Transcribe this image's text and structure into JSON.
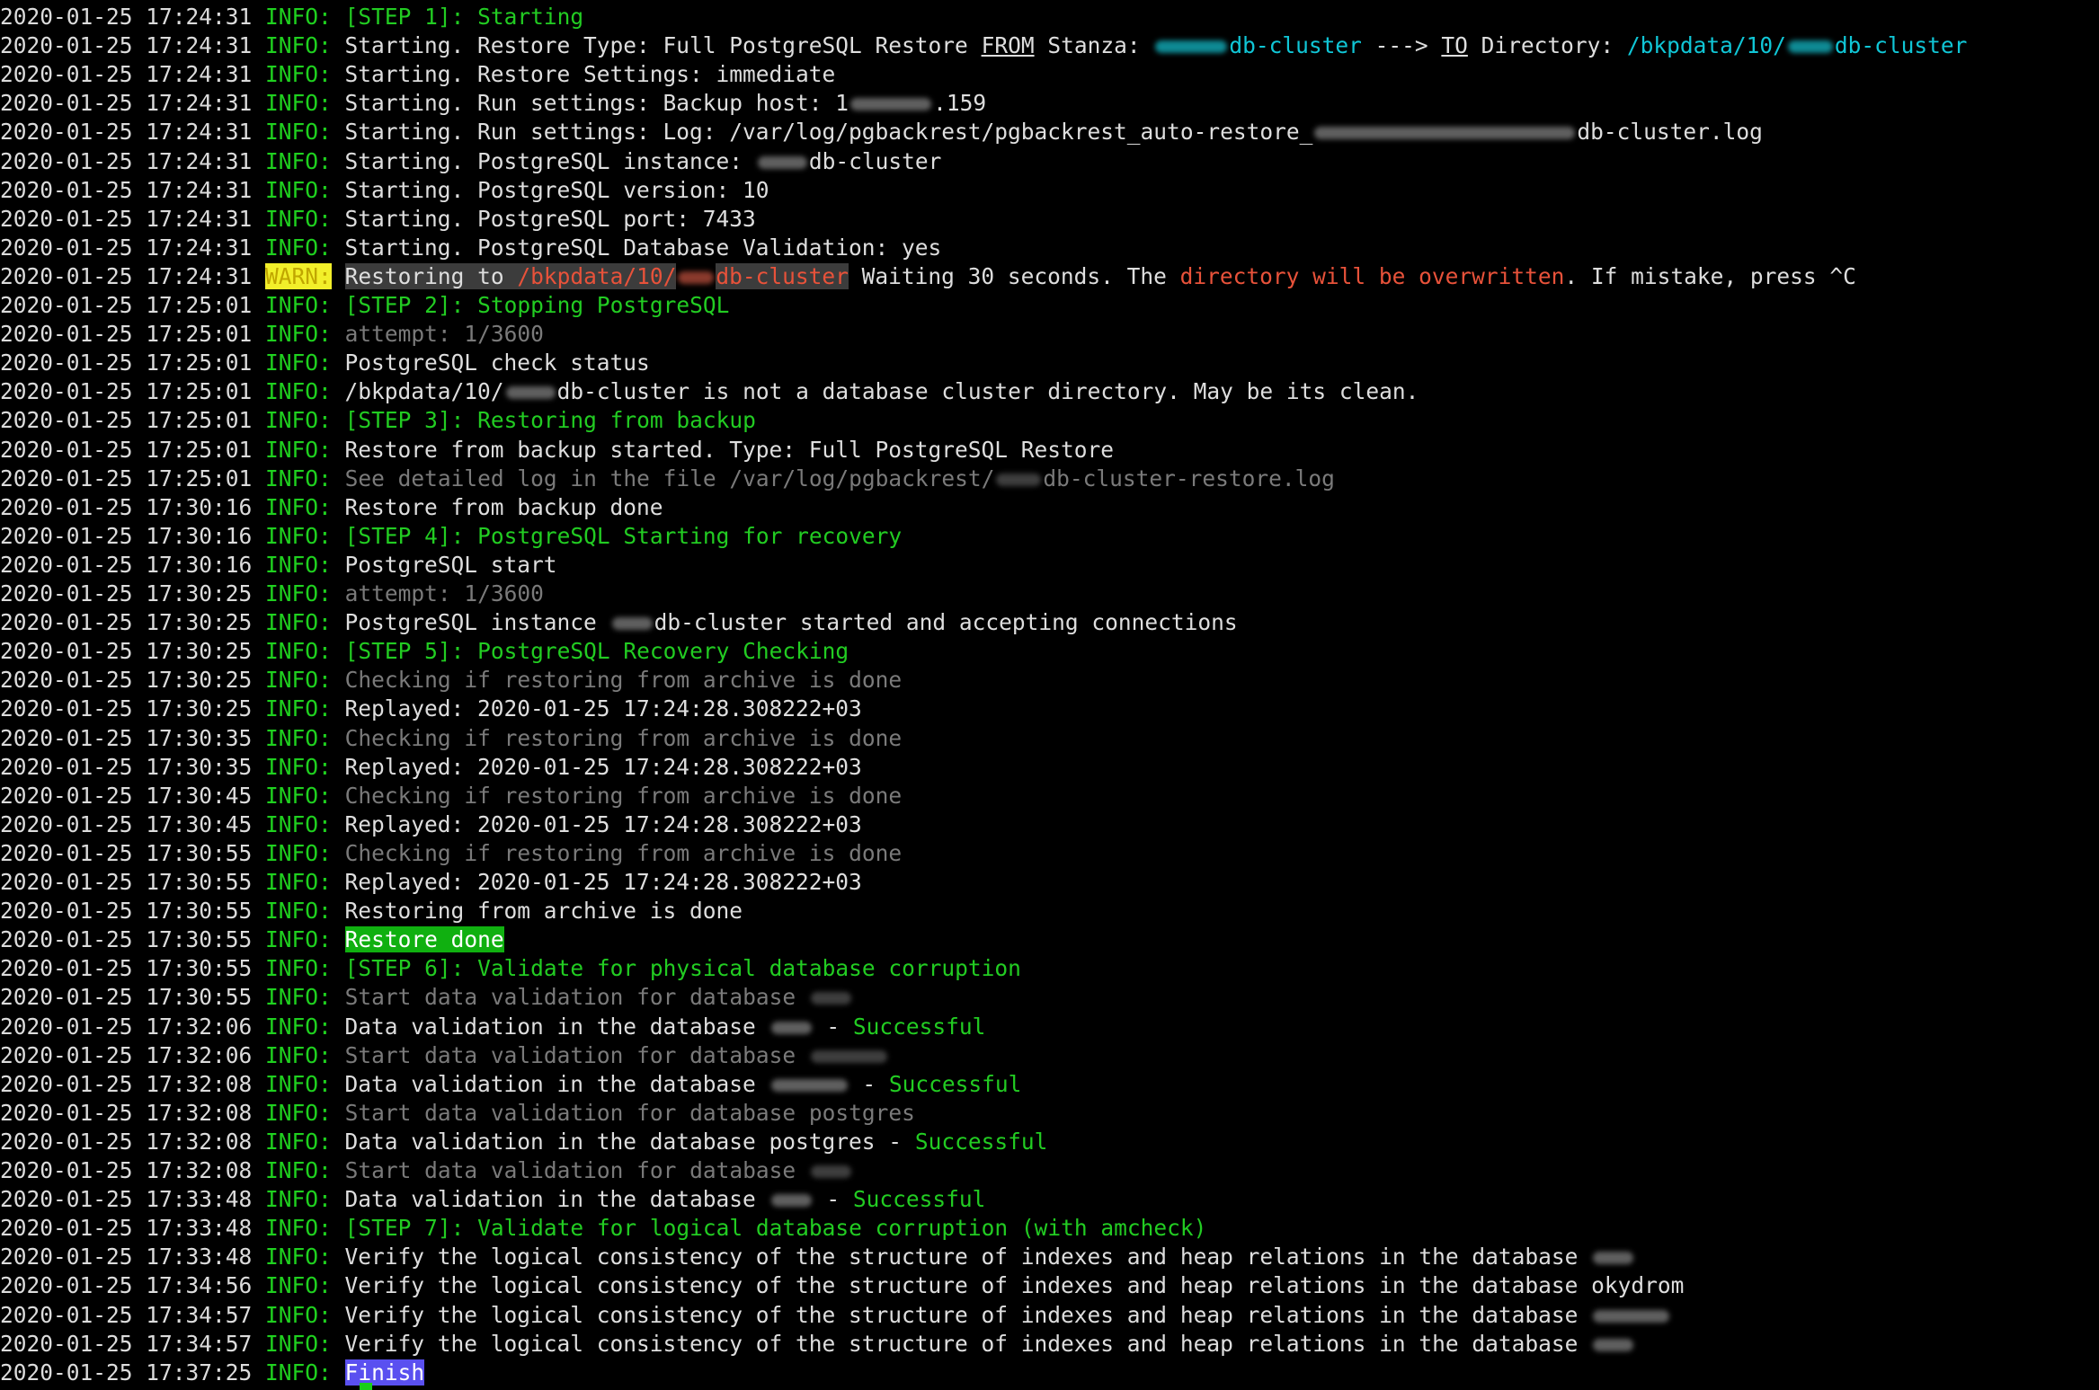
{
  "terminal": {
    "lines": [
      {
        "ts": "2020-01-25 17:24:31",
        "level": "INFO:",
        "parts": [
          {
            "t": " "
          },
          {
            "t": "[STEP 1]: Starting",
            "c": "g"
          }
        ]
      },
      {
        "ts": "2020-01-25 17:24:31",
        "level": "INFO:",
        "parts": [
          {
            "t": " Starting. Restore Type: Full PostgreSQL Restore "
          },
          {
            "t": "FROM",
            "c": "w u"
          },
          {
            "t": " Stanza: "
          },
          {
            "blur": 80,
            "c": "cb"
          },
          {
            "t": "db-cluster",
            "c": "c"
          },
          {
            "t": " ---> "
          },
          {
            "t": "TO",
            "c": "w u"
          },
          {
            "t": " Directory: "
          },
          {
            "t": "/bkpdata/10/",
            "c": "c"
          },
          {
            "blur": 50,
            "c": "cb"
          },
          {
            "t": "db-cluster",
            "c": "c"
          }
        ]
      },
      {
        "ts": "2020-01-25 17:24:31",
        "level": "INFO:",
        "parts": [
          {
            "t": " Starting. Restore Settings: immediate"
          }
        ]
      },
      {
        "ts": "2020-01-25 17:24:31",
        "level": "INFO:",
        "parts": [
          {
            "t": " Starting. Run settings: Backup host: 1"
          },
          {
            "blur": 90
          },
          {
            "t": ".159"
          }
        ]
      },
      {
        "ts": "2020-01-25 17:24:31",
        "level": "INFO:",
        "parts": [
          {
            "t": " Starting. Run settings: Log: /var/log/pgbackrest/pgbackrest_auto-restore_"
          },
          {
            "blur": 290
          },
          {
            "t": "db-cluster.log"
          }
        ]
      },
      {
        "ts": "2020-01-25 17:24:31",
        "level": "INFO:",
        "parts": [
          {
            "t": " Starting. PostgreSQL instance: "
          },
          {
            "blur": 55
          },
          {
            "t": "db-cluster"
          }
        ]
      },
      {
        "ts": "2020-01-25 17:24:31",
        "level": "INFO:",
        "parts": [
          {
            "t": " Starting. PostgreSQL version: 10"
          }
        ]
      },
      {
        "ts": "2020-01-25 17:24:31",
        "level": "INFO:",
        "parts": [
          {
            "t": " Starting. PostgreSQL port: 7433"
          }
        ]
      },
      {
        "ts": "2020-01-25 17:24:31",
        "level": "INFO:",
        "parts": [
          {
            "t": " Starting. PostgreSQL Database Validation: yes"
          }
        ]
      },
      {
        "ts": "2020-01-25 17:24:31",
        "level": "WARN:",
        "warn": true,
        "parts": [
          {
            "t": " "
          },
          {
            "t": "Restoring to ",
            "c": "w hl"
          },
          {
            "t": "/bkpdata/10/",
            "c": "r hl"
          },
          {
            "blur": 40,
            "c": "rb"
          },
          {
            "t": "db-cluster",
            "c": "r hl"
          },
          {
            "t": " Waiting 30 seconds. The "
          },
          {
            "t": "directory will be overwritten",
            "c": "r"
          },
          {
            "t": ". If mistake, press ^C"
          }
        ]
      },
      {
        "ts": "2020-01-25 17:25:01",
        "level": "INFO:",
        "parts": [
          {
            "t": " "
          },
          {
            "t": "[STEP 2]: Stopping PostgreSQL",
            "c": "g"
          }
        ]
      },
      {
        "ts": "2020-01-25 17:25:01",
        "level": "INFO:",
        "parts": [
          {
            "t": " "
          },
          {
            "t": "attempt: 1/3600",
            "c": "d"
          }
        ]
      },
      {
        "ts": "2020-01-25 17:25:01",
        "level": "INFO:",
        "parts": [
          {
            "t": " PostgreSQL check status"
          }
        ]
      },
      {
        "ts": "2020-01-25 17:25:01",
        "level": "INFO:",
        "parts": [
          {
            "t": " /bkpdata/10/"
          },
          {
            "blur": 55
          },
          {
            "t": "db-cluster is not a database cluster directory. May be its clean."
          }
        ]
      },
      {
        "ts": "2020-01-25 17:25:01",
        "level": "INFO:",
        "parts": [
          {
            "t": " "
          },
          {
            "t": "[STEP 3]: Restoring from backup",
            "c": "g"
          }
        ]
      },
      {
        "ts": "2020-01-25 17:25:01",
        "level": "INFO:",
        "parts": [
          {
            "t": " Restore from backup started. Type: Full PostgreSQL Restore"
          }
        ]
      },
      {
        "ts": "2020-01-25 17:25:01",
        "level": "INFO:",
        "parts": [
          {
            "t": " "
          },
          {
            "t": "See detailed log in the file /var/log/pgbackrest/",
            "c": "d"
          },
          {
            "blur": 50,
            "c": "db"
          },
          {
            "t": "db-cluster-restore.log",
            "c": "d"
          }
        ]
      },
      {
        "ts": "2020-01-25 17:30:16",
        "level": "INFO:",
        "parts": [
          {
            "t": " Restore from backup done"
          }
        ]
      },
      {
        "ts": "2020-01-25 17:30:16",
        "level": "INFO:",
        "parts": [
          {
            "t": " "
          },
          {
            "t": "[STEP 4]: PostgreSQL Starting for recovery",
            "c": "g"
          }
        ]
      },
      {
        "ts": "2020-01-25 17:30:16",
        "level": "INFO:",
        "parts": [
          {
            "t": " PostgreSQL start"
          }
        ]
      },
      {
        "ts": "2020-01-25 17:30:25",
        "level": "INFO:",
        "parts": [
          {
            "t": " "
          },
          {
            "t": "attempt: 1/3600",
            "c": "d"
          }
        ]
      },
      {
        "ts": "2020-01-25 17:30:25",
        "level": "INFO:",
        "parts": [
          {
            "t": " PostgreSQL instance "
          },
          {
            "blur": 45
          },
          {
            "t": "db-cluster started and accepting connections"
          }
        ]
      },
      {
        "ts": "2020-01-25 17:30:25",
        "level": "INFO:",
        "parts": [
          {
            "t": " "
          },
          {
            "t": "[STEP 5]: PostgreSQL Recovery Checking",
            "c": "g"
          }
        ]
      },
      {
        "ts": "2020-01-25 17:30:25",
        "level": "INFO:",
        "parts": [
          {
            "t": " "
          },
          {
            "t": "Checking if restoring from archive is done",
            "c": "d"
          }
        ]
      },
      {
        "ts": "2020-01-25 17:30:25",
        "level": "INFO:",
        "parts": [
          {
            "t": " Replayed: 2020-01-25 17:24:28.308222+03"
          }
        ]
      },
      {
        "ts": "2020-01-25 17:30:35",
        "level": "INFO:",
        "parts": [
          {
            "t": " "
          },
          {
            "t": "Checking if restoring from archive is done",
            "c": "d"
          }
        ]
      },
      {
        "ts": "2020-01-25 17:30:35",
        "level": "INFO:",
        "parts": [
          {
            "t": " Replayed: 2020-01-25 17:24:28.308222+03"
          }
        ]
      },
      {
        "ts": "2020-01-25 17:30:45",
        "level": "INFO:",
        "parts": [
          {
            "t": " "
          },
          {
            "t": "Checking if restoring from archive is done",
            "c": "d"
          }
        ]
      },
      {
        "ts": "2020-01-25 17:30:45",
        "level": "INFO:",
        "parts": [
          {
            "t": " Replayed: 2020-01-25 17:24:28.308222+03"
          }
        ]
      },
      {
        "ts": "2020-01-25 17:30:55",
        "level": "INFO:",
        "parts": [
          {
            "t": " "
          },
          {
            "t": "Checking if restoring from archive is done",
            "c": "d"
          }
        ]
      },
      {
        "ts": "2020-01-25 17:30:55",
        "level": "INFO:",
        "parts": [
          {
            "t": " Replayed: 2020-01-25 17:24:28.308222+03"
          }
        ]
      },
      {
        "ts": "2020-01-25 17:30:55",
        "level": "INFO:",
        "parts": [
          {
            "t": " Restoring from archive is done"
          }
        ]
      },
      {
        "ts": "2020-01-25 17:30:55",
        "level": "INFO:",
        "parts": [
          {
            "t": " "
          },
          {
            "t": "Restore done",
            "c": "done-hl"
          }
        ]
      },
      {
        "ts": "2020-01-25 17:30:55",
        "level": "INFO:",
        "parts": [
          {
            "t": " "
          },
          {
            "t": "[STEP 6]: Validate for physical database corruption",
            "c": "g"
          }
        ]
      },
      {
        "ts": "2020-01-25 17:30:55",
        "level": "INFO:",
        "parts": [
          {
            "t": " "
          },
          {
            "t": "Start data validation for database ",
            "c": "d"
          },
          {
            "blur": 45,
            "c": "db"
          }
        ]
      },
      {
        "ts": "2020-01-25 17:32:06",
        "level": "INFO:",
        "parts": [
          {
            "t": " Data validation in the database "
          },
          {
            "blur": 45
          },
          {
            "t": " - "
          },
          {
            "t": "Successful",
            "c": "g"
          }
        ]
      },
      {
        "ts": "2020-01-25 17:32:06",
        "level": "INFO:",
        "parts": [
          {
            "t": " "
          },
          {
            "t": "Start data validation for database ",
            "c": "d"
          },
          {
            "blur": 85,
            "c": "db"
          }
        ]
      },
      {
        "ts": "2020-01-25 17:32:08",
        "level": "INFO:",
        "parts": [
          {
            "t": " Data validation in the database "
          },
          {
            "blur": 85
          },
          {
            "t": " - "
          },
          {
            "t": "Successful",
            "c": "g"
          }
        ]
      },
      {
        "ts": "2020-01-25 17:32:08",
        "level": "INFO:",
        "parts": [
          {
            "t": " "
          },
          {
            "t": "Start data validation for database postgres",
            "c": "d"
          }
        ]
      },
      {
        "ts": "2020-01-25 17:32:08",
        "level": "INFO:",
        "parts": [
          {
            "t": " Data validation in the database postgres - "
          },
          {
            "t": "Successful",
            "c": "g"
          }
        ]
      },
      {
        "ts": "2020-01-25 17:32:08",
        "level": "INFO:",
        "parts": [
          {
            "t": " "
          },
          {
            "t": "Start data validation for database ",
            "c": "d"
          },
          {
            "blur": 45,
            "c": "db"
          }
        ]
      },
      {
        "ts": "2020-01-25 17:33:48",
        "level": "INFO:",
        "parts": [
          {
            "t": " Data validation in the database "
          },
          {
            "blur": 45
          },
          {
            "t": " - "
          },
          {
            "t": "Successful",
            "c": "g"
          }
        ]
      },
      {
        "ts": "2020-01-25 17:33:48",
        "level": "INFO:",
        "parts": [
          {
            "t": " "
          },
          {
            "t": "[STEP 7]: Validate for logical database corruption (with amcheck)",
            "c": "g"
          }
        ]
      },
      {
        "ts": "2020-01-25 17:33:48",
        "level": "INFO:",
        "parts": [
          {
            "t": " Verify the logical consistency of the structure of indexes and heap relations in the database "
          },
          {
            "blur": 45
          }
        ]
      },
      {
        "ts": "2020-01-25 17:34:56",
        "level": "INFO:",
        "parts": [
          {
            "t": " Verify the logical consistency of the structure of indexes and heap relations in the database okydrom"
          }
        ]
      },
      {
        "ts": "2020-01-25 17:34:57",
        "level": "INFO:",
        "parts": [
          {
            "t": " Verify the logical consistency of the structure of indexes and heap relations in the database "
          },
          {
            "blur": 85
          }
        ]
      },
      {
        "ts": "2020-01-25 17:34:57",
        "level": "INFO:",
        "parts": [
          {
            "t": " Verify the logical consistency of the structure of indexes and heap relations in the database "
          },
          {
            "blur": 45
          }
        ]
      },
      {
        "ts": "2020-01-25 17:37:25",
        "level": "INFO:",
        "parts": [
          {
            "t": " "
          },
          {
            "t": "Finish",
            "c": "finish-hl"
          }
        ]
      }
    ]
  }
}
